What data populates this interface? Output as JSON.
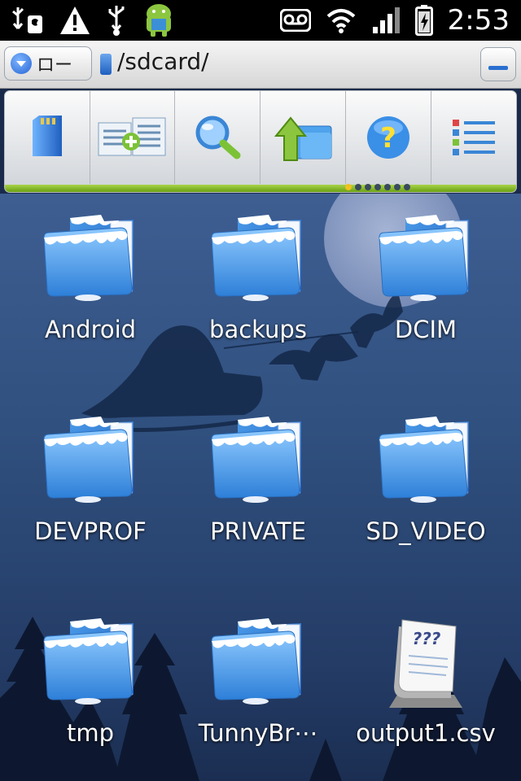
{
  "status_bar": {
    "icons": [
      "usb-debug-icon",
      "warning-icon",
      "usb-icon",
      "android-icon",
      "voicemail-icon",
      "wifi-icon",
      "signal-icon",
      "battery-charging-icon"
    ],
    "time": "2:53"
  },
  "path_bar": {
    "location_button": "ロー",
    "path": "/sdcard/"
  },
  "toolbar": {
    "buttons": [
      "sdcard-icon",
      "multi-select-icon",
      "search-icon",
      "up-folder-icon",
      "help-icon",
      "list-view-icon"
    ],
    "page_count": 7,
    "current_page": 0
  },
  "files": [
    {
      "name": "Android",
      "type": "folder"
    },
    {
      "name": "backups",
      "type": "folder"
    },
    {
      "name": "DCIM",
      "type": "folder"
    },
    {
      "name": "DEVPROF",
      "type": "folder"
    },
    {
      "name": "PRIVATE",
      "type": "folder"
    },
    {
      "name": "SD_VIDEO",
      "type": "folder"
    },
    {
      "name": "tmp",
      "type": "folder"
    },
    {
      "name": "TunnyBr⋯",
      "type": "folder"
    },
    {
      "name": "output1.csv",
      "type": "unknown-file"
    }
  ],
  "colors": {
    "accent_green": "#8cc63f",
    "folder_blue": "#4ea3ec",
    "wallpaper_blue": "#30507f"
  }
}
